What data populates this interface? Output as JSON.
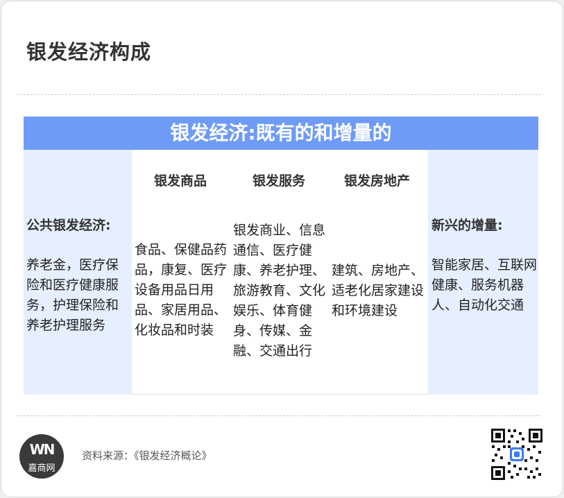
{
  "page": {
    "title": "银发经济构成"
  },
  "banner": {
    "title": "银发经济:既有的和增量的"
  },
  "columns": {
    "public": {
      "heading": "公共银发经济:",
      "body": "养老金，医疗保险和医疗健康服务，护理保险和养老护理服务"
    },
    "goods": {
      "heading": "银发商品",
      "body": "食品、保健品药品，康复、医疗设备用品日用品、家居用品、化妆品和时装"
    },
    "services": {
      "heading": "银发服务",
      "body": "银发商业、信息通信、医疗健康、养老护理、旅游教育、文化娱乐、体育健身、传媒、金融、交通出行"
    },
    "realestate": {
      "heading": "银发房地产",
      "body": "建筑、房地产、适老化居家建设和环境建设"
    },
    "emerging": {
      "heading": "新兴的增量:",
      "body": "智能家居、互联网健康、服务机器人、自动化交通"
    }
  },
  "footer": {
    "logo_mark": "WN",
    "logo_text": "嘉商网",
    "source": "资料来源：《银发经济概论》"
  },
  "colors": {
    "banner": "#6e9bf5",
    "side_columns": "#e6efff",
    "title_text": "#333333"
  }
}
